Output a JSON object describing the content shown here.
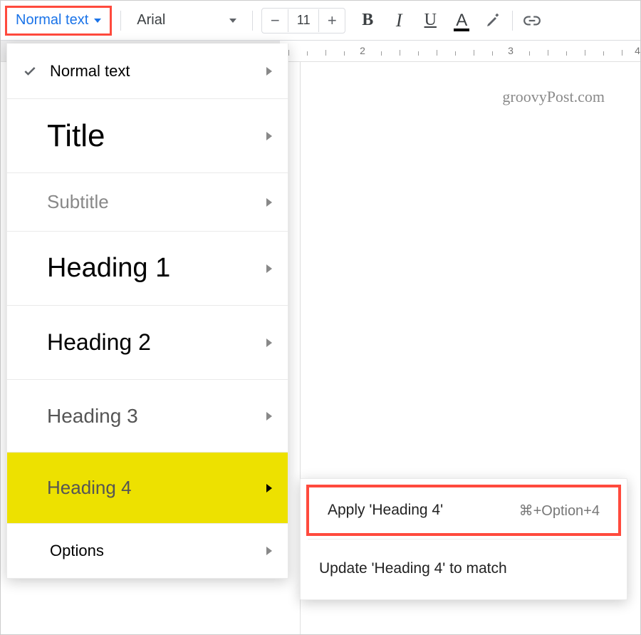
{
  "toolbar": {
    "style_selector": "Normal text",
    "font_selector": "Arial",
    "font_size": "11"
  },
  "styles_menu": {
    "normal": "Normal text",
    "title": "Title",
    "subtitle": "Subtitle",
    "h1": "Heading 1",
    "h2": "Heading 2",
    "h3": "Heading 3",
    "h4": "Heading 4",
    "options": "Options"
  },
  "submenu": {
    "apply": "Apply 'Heading 4'",
    "apply_shortcut": "⌘+Option+4",
    "update": "Update 'Heading 4' to match"
  },
  "ruler": {
    "n2": "2",
    "n3": "3",
    "n4": "4"
  },
  "watermark": "groovyPost.com"
}
